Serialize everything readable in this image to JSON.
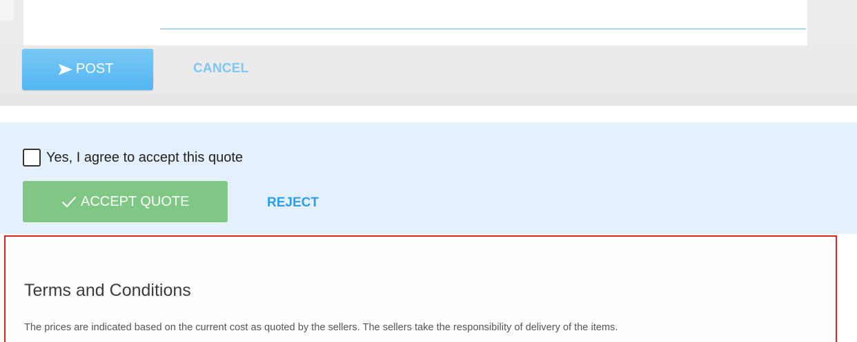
{
  "composer": {
    "post_label": "POST",
    "cancel_label": "CANCEL",
    "post_icon": "send-icon"
  },
  "quote": {
    "agree_label": "Yes, I agree to accept this quote",
    "agree_checked": false,
    "accept_label": "ACCEPT QUOTE",
    "accept_icon": "checkmark-icon",
    "reject_label": "REJECT"
  },
  "terms": {
    "title": "Terms and Conditions",
    "text": "The prices are indicated based on the current cost as quoted by the sellers. The sellers take the responsibility of delivery of the items."
  },
  "colors": {
    "post_button": "#52b6f1",
    "cancel_link": "#7fc6f3",
    "accept_button": "#80c685",
    "reject_link": "#2a9df0",
    "quote_panel_bg": "#e4f0fb",
    "highlight_border": "#e01e1e"
  }
}
